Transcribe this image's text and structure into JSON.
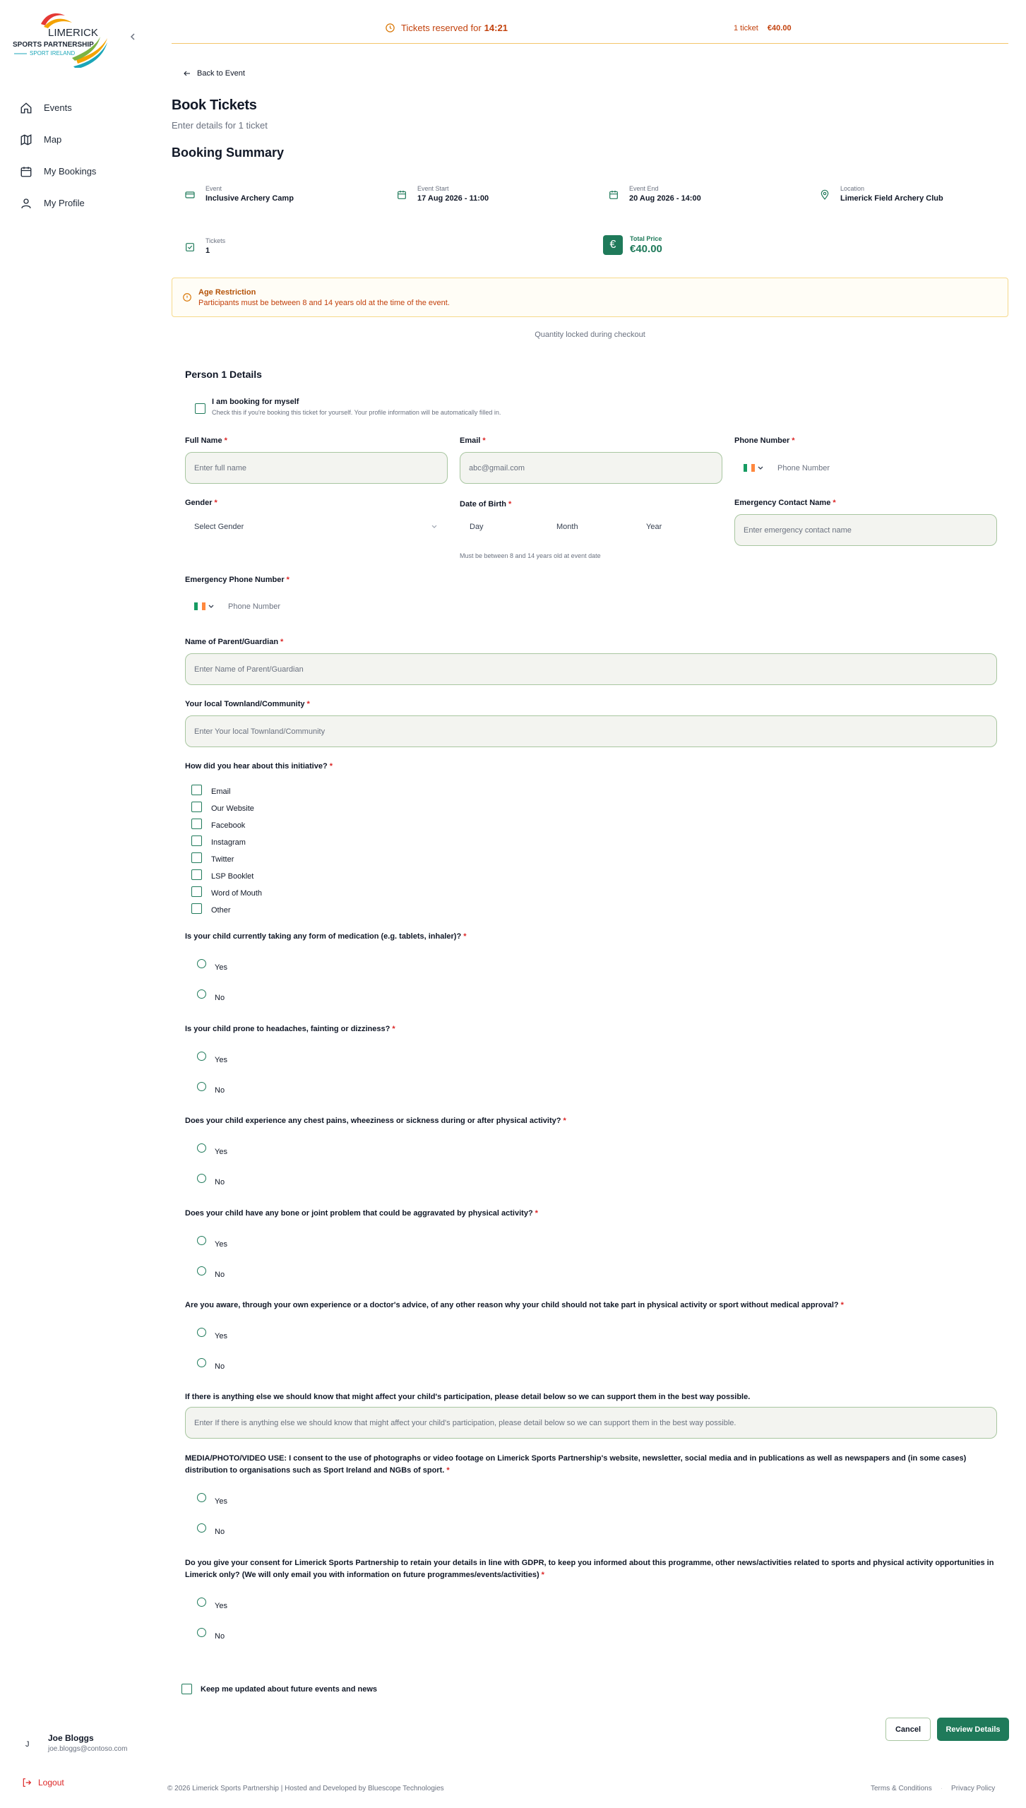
{
  "sidebar": {
    "logo": {
      "line1": "LIMERICK",
      "line2": "SPORTS PARTNERSHIP",
      "line3": "SPORT IRELAND"
    },
    "nav": [
      {
        "label": "Events",
        "icon": "home-icon"
      },
      {
        "label": "Map",
        "icon": "map-icon"
      },
      {
        "label": "My Bookings",
        "icon": "calendar-icon"
      },
      {
        "label": "My Profile",
        "icon": "user-icon"
      }
    ],
    "user": {
      "initial": "J",
      "name": "Joe Bloggs",
      "email": "joe.bloggs@contoso.com"
    },
    "logout_label": "Logout"
  },
  "topbar": {
    "timer_prefix": "Tickets reserved for",
    "timer_value": "14:21",
    "ticket_count": "1 ticket",
    "ticket_price": "€40.00"
  },
  "page": {
    "back_label": "Back to Event",
    "title": "Book Tickets",
    "subtitle": "Enter details for 1 ticket",
    "summary_title": "Booking Summary"
  },
  "summary": {
    "event": {
      "label": "Event",
      "value": "Inclusive Archery Camp"
    },
    "start": {
      "label": "Event Start",
      "value": "17 Aug 2026 - 11:00"
    },
    "end": {
      "label": "Event End",
      "value": "20 Aug 2026 - 14:00"
    },
    "location": {
      "label": "Location",
      "value": "Limerick Field Archery Club"
    },
    "tickets": {
      "label": "Tickets",
      "value": "1"
    },
    "total": {
      "label": "Total Price",
      "value": "€40.00",
      "symbol": "€"
    }
  },
  "age_restriction": {
    "title": "Age Restriction",
    "text": "Participants must be between 8 and 14 years old at the time of the event."
  },
  "quantity_locked": "Quantity locked during checkout",
  "form": {
    "section_title": "Person 1 Details",
    "myself": {
      "title": "I am booking for myself",
      "desc": "Check this if you're booking this ticket for yourself. Your profile information will be automatically filled in."
    },
    "full_name": {
      "label": "Full Name",
      "placeholder": "Enter full name"
    },
    "email": {
      "label": "Email",
      "placeholder": "abc@gmail.com"
    },
    "phone": {
      "label": "Phone Number",
      "placeholder": "Phone Number"
    },
    "gender": {
      "label": "Gender",
      "placeholder": "Select Gender"
    },
    "dob": {
      "label": "Date of Birth",
      "day": "Day",
      "month": "Month",
      "year": "Year",
      "hint": "Must be between 8 and 14 years old at event date"
    },
    "emergency_name": {
      "label": "Emergency Contact Name",
      "placeholder": "Enter emergency contact name"
    },
    "emergency_phone": {
      "label": "Emergency Phone Number",
      "placeholder": "Phone Number"
    },
    "guardian": {
      "label": "Name of Parent/Guardian",
      "placeholder": "Enter Name of Parent/Guardian"
    },
    "townland": {
      "label": "Your local Townland/Community",
      "placeholder": "Enter Your local Townland/Community"
    },
    "heard": {
      "label": "How did you hear about this initiative?",
      "options": [
        "Email",
        "Our Website",
        "Facebook",
        "Instagram",
        "Twitter",
        "LSP Booklet",
        "Word of Mouth",
        "Other"
      ]
    },
    "questions": [
      {
        "text": "Is your child currently taking any form of medication (e.g. tablets, inhaler)?",
        "required": "*"
      },
      {
        "text": "Is your child prone to headaches, fainting or dizziness?",
        "required": "*"
      },
      {
        "text": "Does your child experience any chest pains, wheeziness or sickness during or after physical activity?",
        "required": "*"
      },
      {
        "text": "Does your child have any bone or joint problem that could be aggravated by physical activity?",
        "required": "*"
      },
      {
        "text": "Are you aware, through your own experience or a doctor's advice, of any other reason why your child should not take part in physical activity or sport without medical approval?",
        "required": "*"
      }
    ],
    "yes_label": "Yes",
    "no_label": "No",
    "anything_else": {
      "label": "If there is anything else we should know that might affect your child's participation, please detail below so we can support them in the best way possible.",
      "placeholder": "Enter If there is anything else we should know that might affect your child's participation, please detail below so we can support them in the best way possible."
    },
    "media_question": "MEDIA/PHOTO/VIDEO USE: I consent to the use of photographs or video footage on Limerick Sports Partnership's website, newsletter, social media and in publications as well as newspapers and (in some cases) distribution to organisations such as Sport Ireland and NGBs of sport.",
    "gdpr_question": "Do you give your consent for Limerick Sports Partnership to retain your details in line with GDPR, to keep you informed about this programme, other news/activities related to sports and physical activity opportunities in Limerick only? (We will only email you with information on future programmes/events/activities)",
    "required_mark": "*",
    "keep_updated": "Keep me updated about future events and news",
    "cancel_label": "Cancel",
    "review_label": "Review Details"
  },
  "footer": {
    "left": "© 2026 Limerick Sports Partnership  |  Hosted and Developed by Bluescope Technologies",
    "terms": "Terms & Conditions",
    "separator": "·",
    "privacy": "Privacy Policy"
  },
  "colors": {
    "brand": "#1f7a5a",
    "warning": "#c2410c",
    "required": "#dc2626"
  }
}
